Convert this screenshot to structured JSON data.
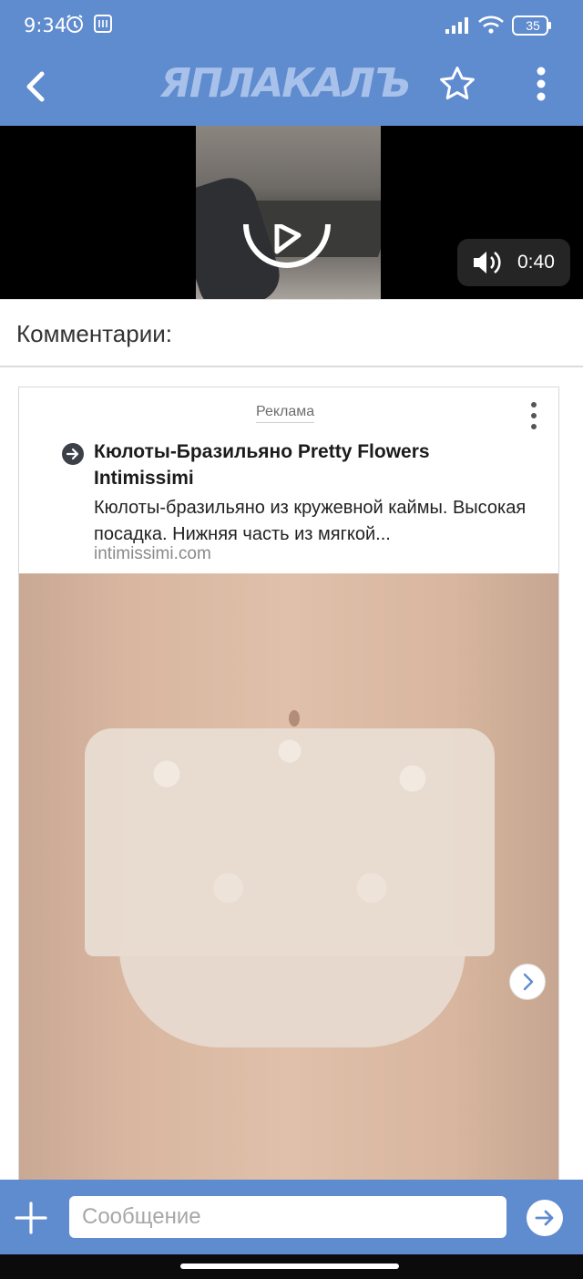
{
  "status_bar": {
    "time": "9:34",
    "battery": "35",
    "icons": [
      "alarm-icon",
      "notification-icon",
      "signal-icon",
      "wifi-icon",
      "battery-icon"
    ]
  },
  "app_bar": {
    "logo": "ЯПЛАКАЛЪ",
    "icons": [
      "back-arrow-icon",
      "star-icon",
      "more-vertical-icon"
    ]
  },
  "video": {
    "duration": "0:40",
    "icons": [
      "play-icon",
      "sound-icon"
    ]
  },
  "comments": {
    "title": "Комментарии:"
  },
  "ad": {
    "label": "Реклама",
    "title": "Кюлоты-Бразильяно Pretty Flowers Intimissimi",
    "description": "Кюлоты-бразильяно из кружевной каймы. Высокая посадка. Нижняя часть из мягкой...",
    "domain": "intimissimi.com",
    "icons": [
      "arrow-right-circle-icon",
      "more-vertical-icon",
      "chevron-right-icon"
    ]
  },
  "input_bar": {
    "placeholder": "Сообщение",
    "icons": [
      "plus-icon",
      "send-icon"
    ]
  },
  "colors": {
    "brand_blue": "#5f8bcf",
    "logo_light": "#a8c1ea",
    "nav_black": "#0b0b0b"
  }
}
